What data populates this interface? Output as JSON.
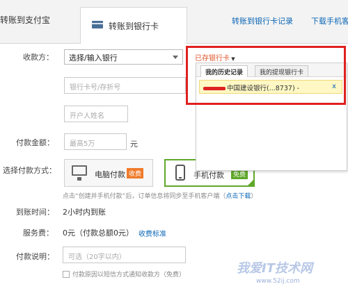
{
  "tabs": {
    "alipay": "转账到支付宝",
    "bank": "转账到银行卡"
  },
  "top_links": {
    "bank_records": "转账到银行卡记录",
    "mobile_download": "下载手机客"
  },
  "form": {
    "payee_label": "收款方：",
    "bank_select_value": "选择/输入银行",
    "saved_cards_link": "已存银行卡",
    "card_number_placeholder": "银行卡号/存折号",
    "account_name_placeholder": "开户人姓名",
    "amount_label": "付款金额：",
    "amount_placeholder": "最高5万",
    "amount_unit": "元",
    "pay_method_label": "选择付款方式：",
    "pc_pay_label": "电脑付款",
    "pc_pay_badge": "收费",
    "mobile_pay_label": "手机付款",
    "mobile_pay_badge": "免费",
    "hint_prefix": "点击“创建并手机付款”后，订单信息将同步至手机客户端（",
    "hint_link": "点击下载",
    "hint_suffix": "）",
    "arrival_label": "到账时间：",
    "arrival_value": "2小时内到账",
    "fee_label": "服务费：",
    "fee_value": "0元（付款总额0元）",
    "fee_link": "收费标准",
    "note_label": "付款说明：",
    "note_placeholder": "可选（20字以内）",
    "notify_checkbox_label": "付款原因以短信方式通知收款方（免费）"
  },
  "dropdown": {
    "tab_history": "我的历史记录",
    "tab_withdraw": "我的提现银行卡",
    "item_text": "中国建设银行(...8737) -",
    "item_close": "x"
  },
  "watermark": {
    "text": "我爱IT技术网",
    "url": "www.52ij.com"
  },
  "colors": {
    "link": "#0b66b5",
    "accent_orange": "#e0542a",
    "selected_green": "#5fa82a",
    "highlight_red": "#e02020"
  }
}
